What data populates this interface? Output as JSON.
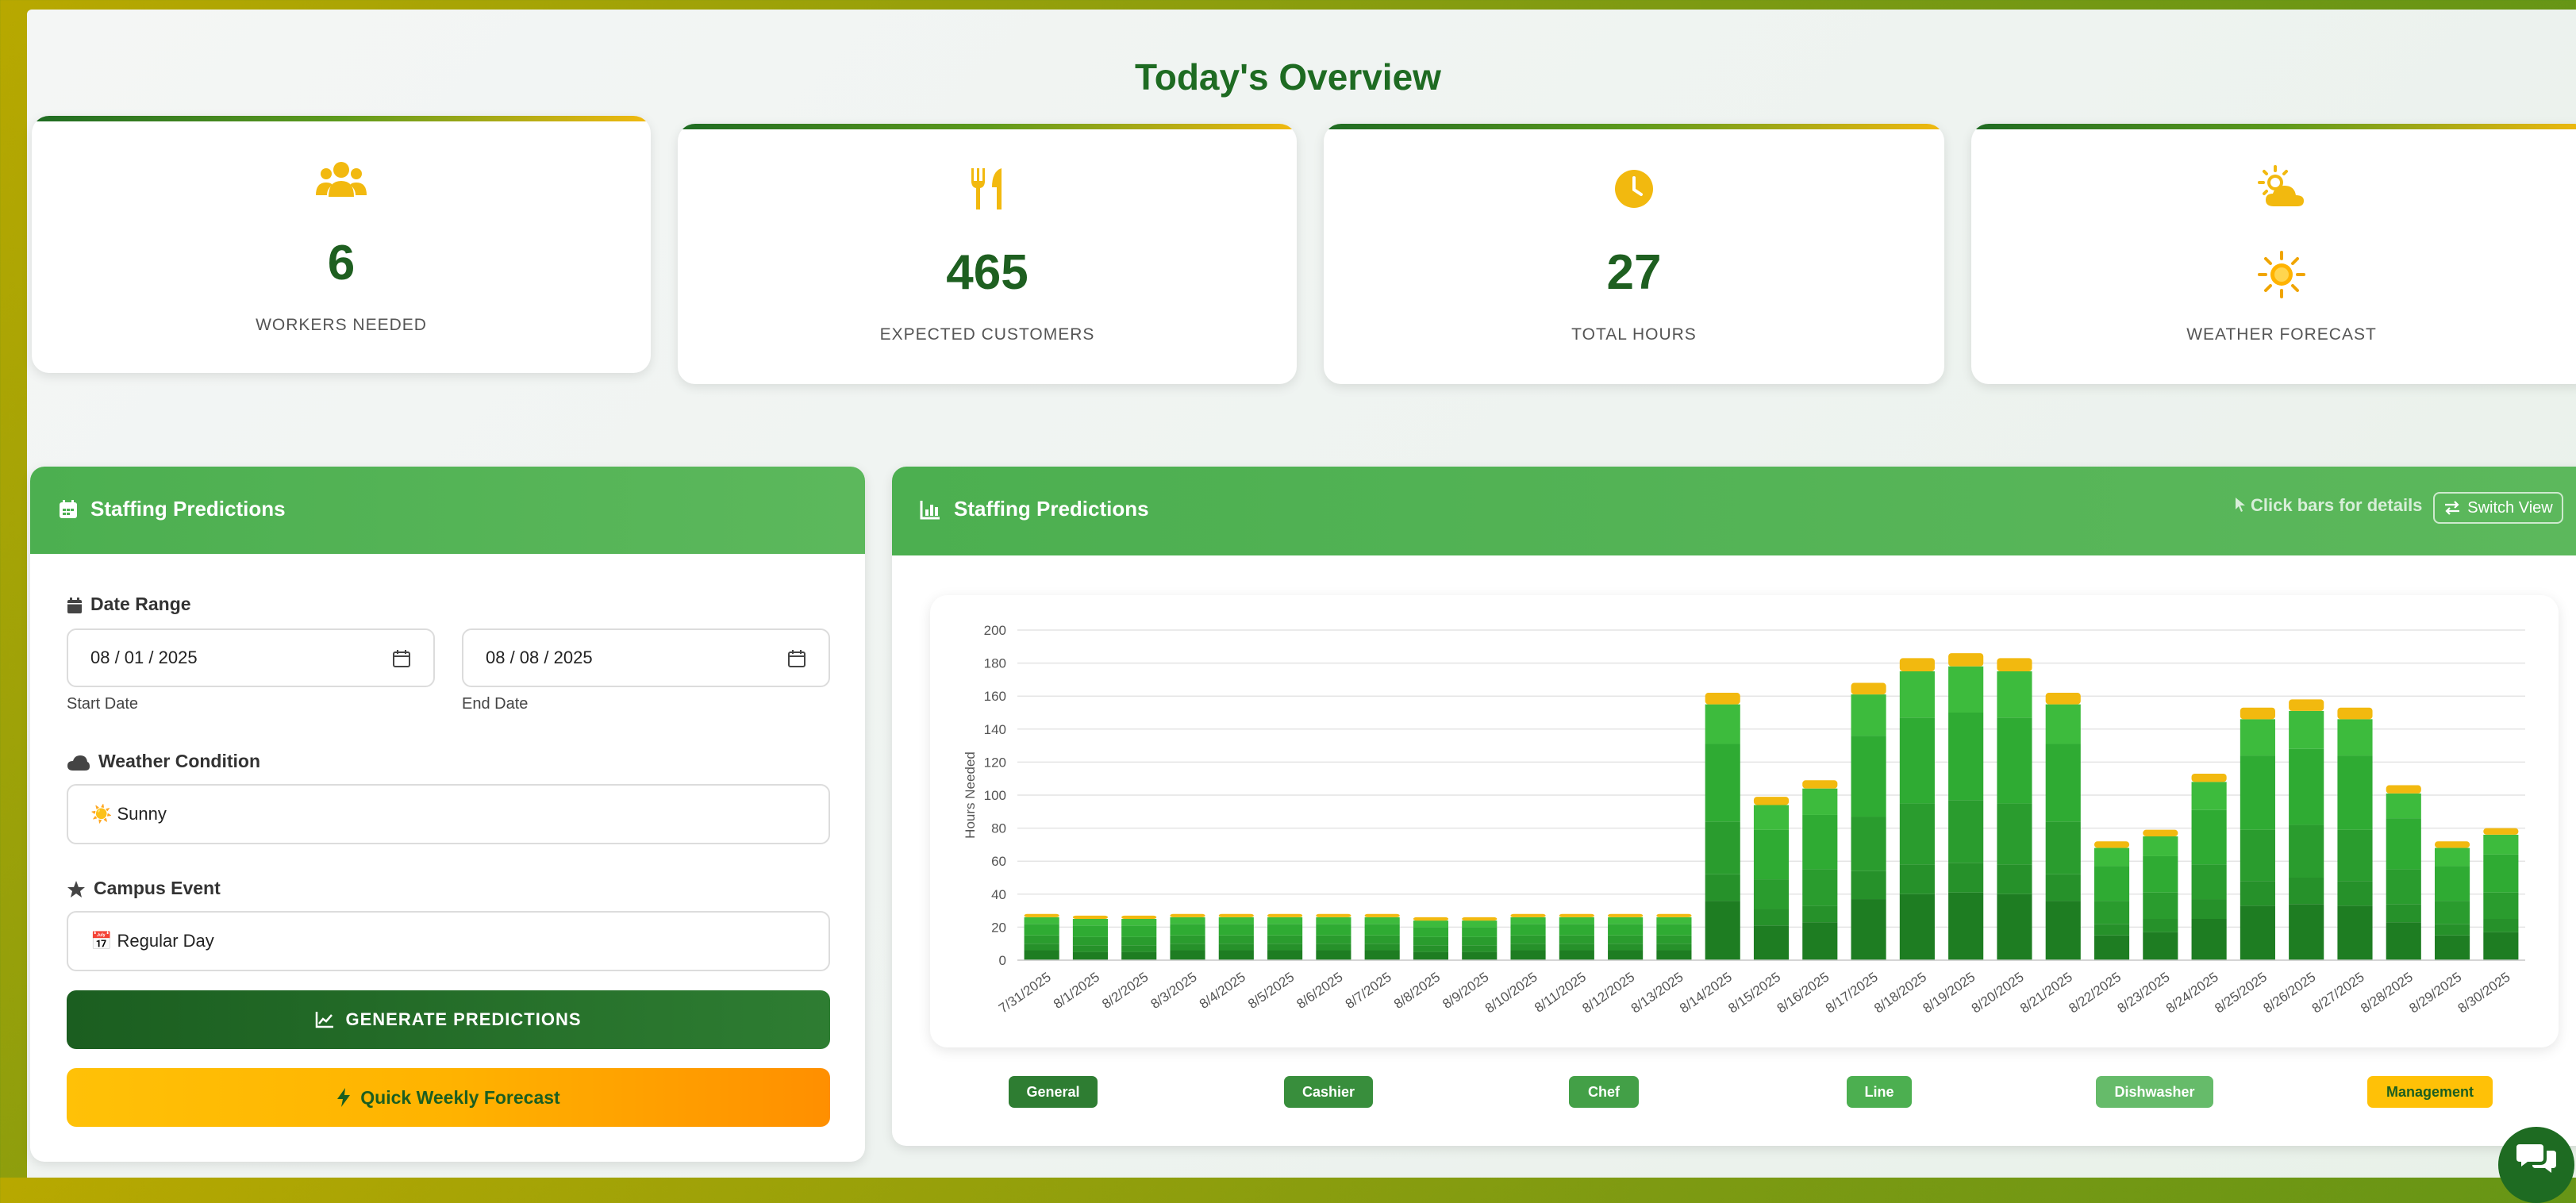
{
  "overview": {
    "title": "Today's Overview",
    "cards": [
      {
        "icon": "users-icon",
        "value": "6",
        "label": "Workers Needed"
      },
      {
        "icon": "utensils-icon",
        "value": "465",
        "label": "Expected Customers"
      },
      {
        "icon": "clock-icon",
        "value": "27",
        "label": "Total Hours"
      },
      {
        "icon": "cloud-sun-icon",
        "value": "",
        "value_icon": "sun-icon",
        "label": "Weather Forecast"
      }
    ]
  },
  "form_panel": {
    "title": "Staffing Predictions",
    "date_range_label": "Date Range",
    "start_date": {
      "value": "08 / 01 / 2025",
      "label": "Start Date"
    },
    "end_date": {
      "value": "08 / 08 / 2025",
      "label": "End Date"
    },
    "weather_label": "Weather Condition",
    "weather_value": "☀️ Sunny",
    "event_label": "Campus Event",
    "event_value": "📅 Regular Day",
    "generate_label": "GENERATE PREDICTIONS",
    "quick_label": "Quick Weekly Forecast"
  },
  "chart_panel": {
    "title": "Staffing Predictions",
    "hint": "Click bars for details",
    "switch_label": "Switch View"
  },
  "colors": {
    "accent_green": "#1e6b22",
    "header_green": "#4caf50",
    "accent_yellow": "#f2b90f"
  },
  "chart_data": {
    "type": "bar",
    "stacked": true,
    "ylabel": "Hours Needed",
    "ylim": [
      0,
      200
    ],
    "yticks": [
      0,
      20,
      40,
      60,
      80,
      100,
      120,
      140,
      160,
      180,
      200
    ],
    "grid": true,
    "categories": [
      "7/31/2025",
      "8/1/2025",
      "8/2/2025",
      "8/3/2025",
      "8/4/2025",
      "8/5/2025",
      "8/6/2025",
      "8/7/2025",
      "8/8/2025",
      "8/9/2025",
      "8/10/2025",
      "8/11/2025",
      "8/12/2025",
      "8/13/2025",
      "8/14/2025",
      "8/15/2025",
      "8/16/2025",
      "8/17/2025",
      "8/18/2025",
      "8/19/2025",
      "8/20/2025",
      "8/21/2025",
      "8/22/2025",
      "8/23/2025",
      "8/24/2025",
      "8/25/2025",
      "8/26/2025",
      "8/27/2025",
      "8/28/2025",
      "8/29/2025",
      "8/30/2025"
    ],
    "series": [
      {
        "name": "General",
        "color": "#1e7d22",
        "values": [
          6,
          5,
          5,
          6,
          6,
          6,
          6,
          6,
          5,
          5,
          6,
          6,
          6,
          6,
          36,
          21,
          23,
          37,
          40,
          41,
          40,
          36,
          15,
          17,
          25,
          33,
          34,
          33,
          23,
          15,
          17
        ]
      },
      {
        "name": "Cashier",
        "color": "#26912a",
        "values": [
          4,
          4,
          4,
          4,
          4,
          4,
          4,
          4,
          4,
          4,
          4,
          4,
          4,
          4,
          16,
          10,
          10,
          17,
          18,
          18,
          18,
          16,
          7,
          8,
          12,
          15,
          16,
          15,
          11,
          7,
          8
        ]
      },
      {
        "name": "Chef",
        "color": "#2a9c2e",
        "values": [
          5,
          5,
          5,
          5,
          5,
          5,
          5,
          5,
          5,
          5,
          5,
          5,
          5,
          5,
          32,
          18,
          22,
          33,
          37,
          38,
          37,
          32,
          14,
          16,
          21,
          31,
          32,
          31,
          21,
          14,
          16
        ]
      },
      {
        "name": "Line",
        "color": "#2fab33",
        "values": [
          7,
          7,
          7,
          7,
          7,
          7,
          7,
          7,
          6,
          6,
          7,
          7,
          7,
          7,
          47,
          30,
          33,
          49,
          52,
          53,
          52,
          47,
          21,
          22,
          33,
          45,
          46,
          45,
          31,
          21,
          23
        ]
      },
      {
        "name": "Dishwasher",
        "color": "#3dbb3d",
        "values": [
          4,
          4,
          4,
          4,
          4,
          4,
          4,
          4,
          4,
          4,
          4,
          4,
          4,
          4,
          24,
          15,
          16,
          25,
          28,
          28,
          28,
          24,
          11,
          12,
          17,
          22,
          23,
          22,
          15,
          11,
          12
        ]
      },
      {
        "name": "Management",
        "color": "#f2b90f",
        "values": [
          2,
          2,
          2,
          2,
          2,
          2,
          2,
          2,
          2,
          2,
          2,
          2,
          2,
          2,
          7,
          5,
          5,
          7,
          8,
          8,
          8,
          7,
          4,
          4,
          5,
          7,
          7,
          7,
          5,
          4,
          4
        ]
      }
    ]
  },
  "legend": [
    {
      "name": "General",
      "color": "#2e7d32"
    },
    {
      "name": "Cashier",
      "color": "#388e3c"
    },
    {
      "name": "Chef",
      "color": "#43a047"
    },
    {
      "name": "Line",
      "color": "#4caf50"
    },
    {
      "name": "Dishwasher",
      "color": "#66bb6a"
    },
    {
      "name": "Management",
      "color": "#ffc107"
    }
  ]
}
